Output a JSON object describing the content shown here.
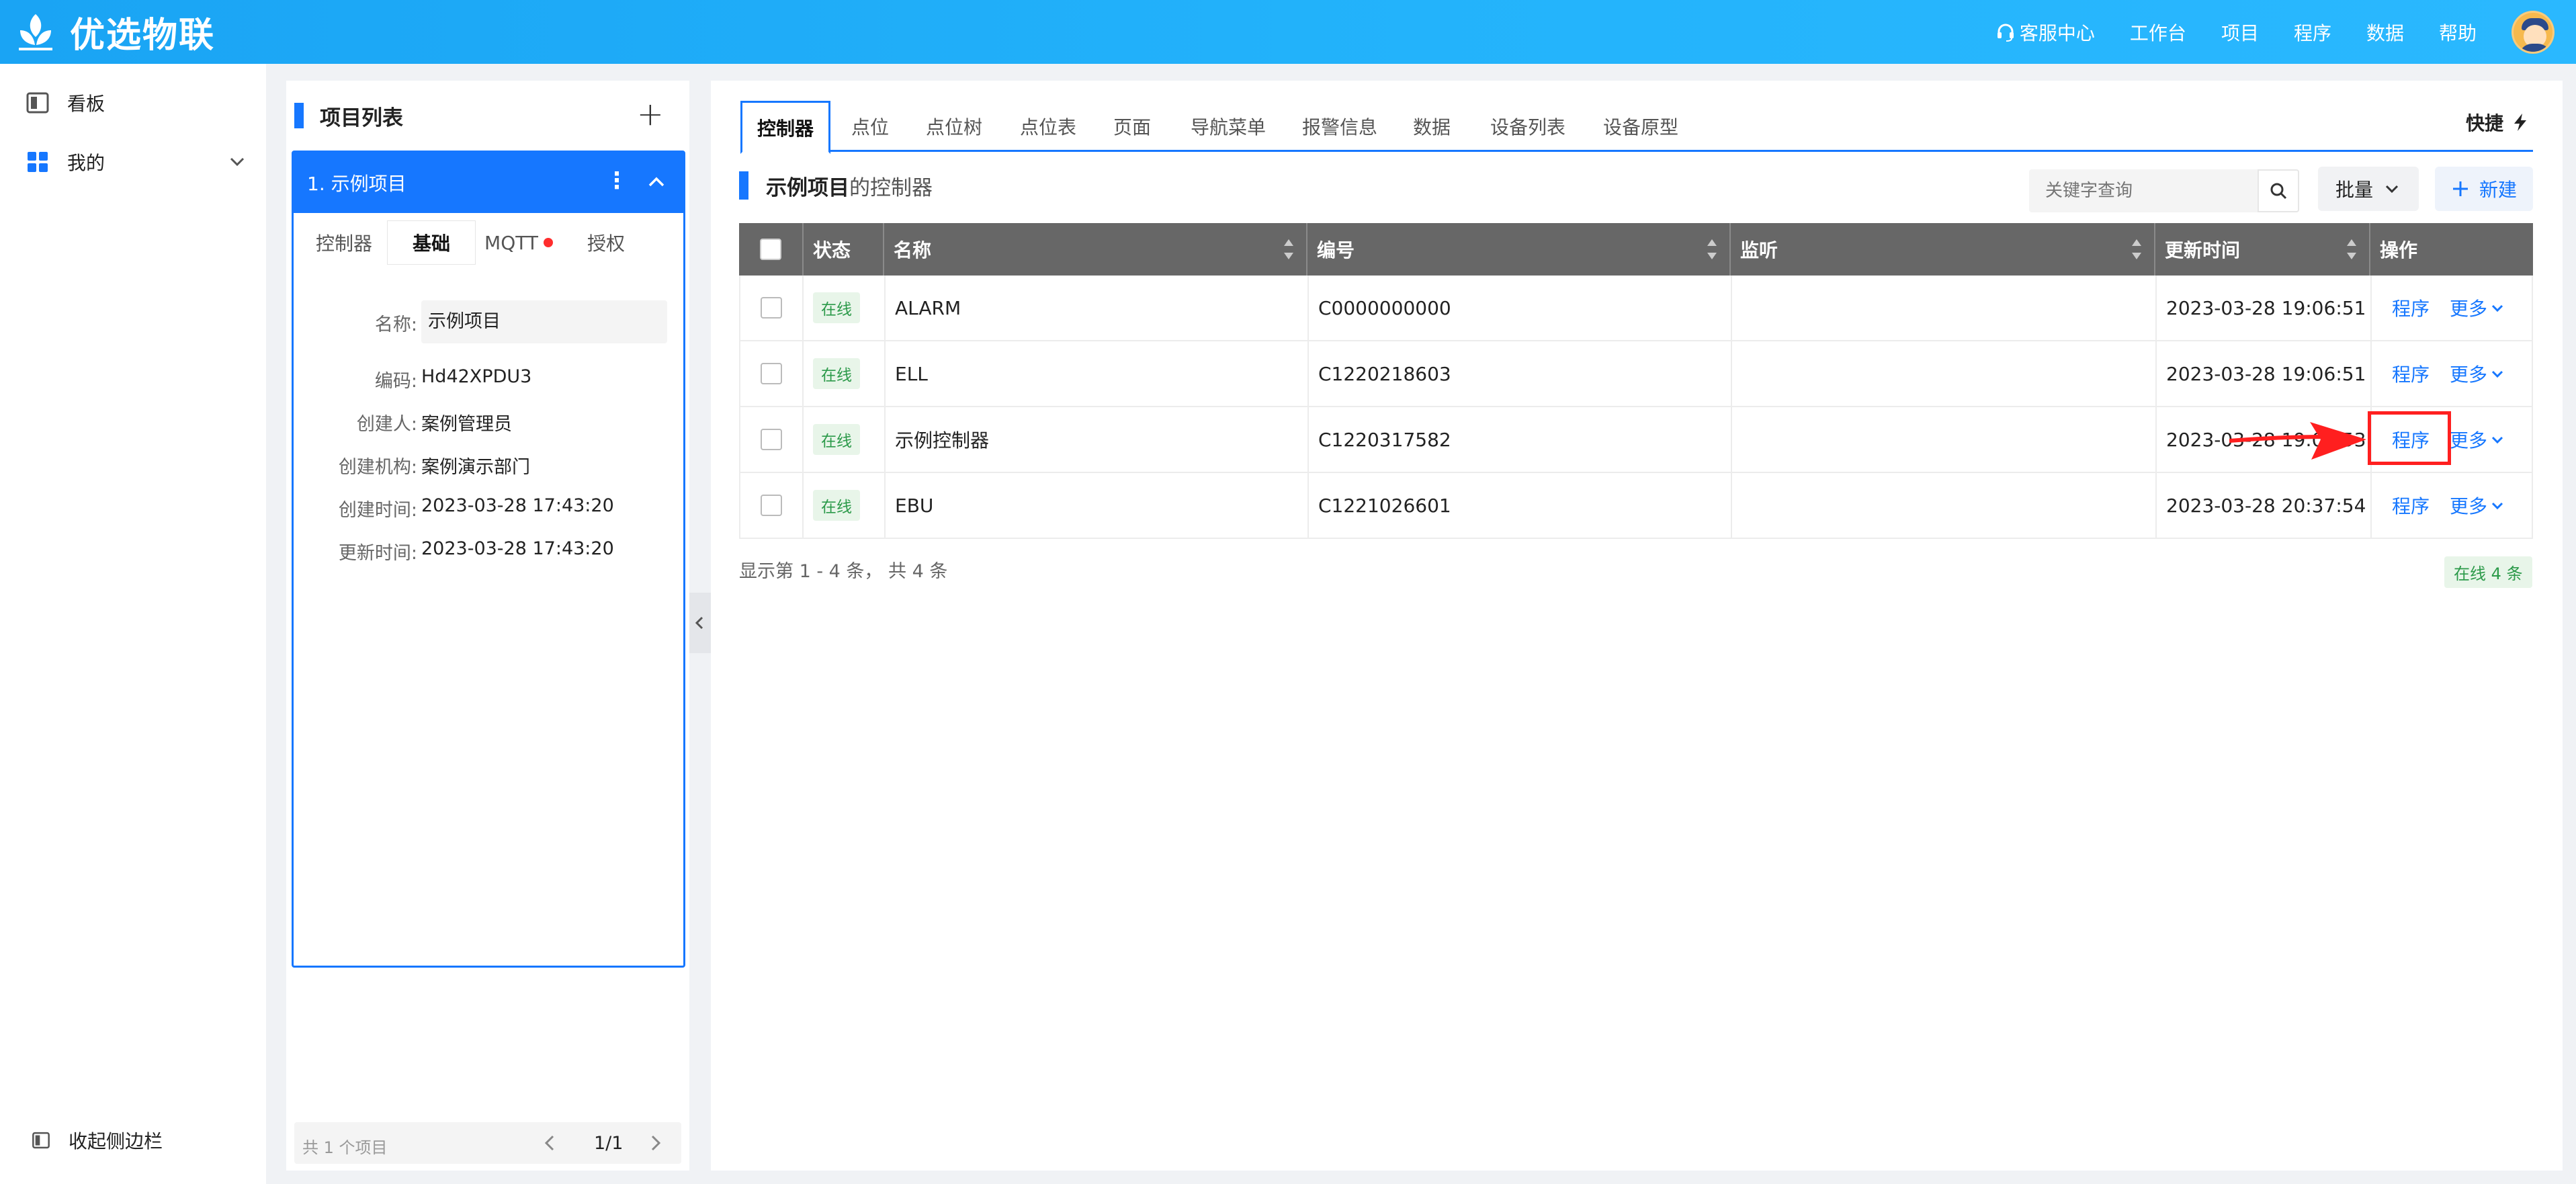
{
  "header": {
    "app_name": "优选物联",
    "nav": [
      {
        "label": "客服中心",
        "icon": "headset-icon"
      },
      {
        "label": "工作台"
      },
      {
        "label": "项目"
      },
      {
        "label": "程序"
      },
      {
        "label": "数据"
      },
      {
        "label": "帮助"
      }
    ]
  },
  "sidebar": {
    "items": [
      {
        "label": "看板",
        "icon": "board-icon"
      },
      {
        "label": "我的",
        "icon": "grid-icon"
      }
    ],
    "collapse_label": "收起侧边栏"
  },
  "project_panel": {
    "title": "项目列表",
    "project": {
      "name": "1. 示例项目",
      "tabs": [
        {
          "label": "控制器"
        },
        {
          "label": "基础",
          "active": true
        },
        {
          "label": "MQTT",
          "dot": true
        },
        {
          "label": "授权"
        }
      ],
      "fields": [
        {
          "label": "名称:",
          "value": "示例项目"
        },
        {
          "label": "编码:",
          "value": "Hd42XPDU3"
        },
        {
          "label": "创建人:",
          "value": "案例管理员"
        },
        {
          "label": "创建机构:",
          "value": "案例演示部门"
        },
        {
          "label": "创建时间:",
          "value": "2023-03-28 17:43:20"
        },
        {
          "label": "更新时间:",
          "value": "2023-03-28 17:43:20"
        }
      ]
    },
    "pager": {
      "total": "共 1 个项目",
      "page": "1/1"
    }
  },
  "main": {
    "tabs": [
      "控制器",
      "点位",
      "点位树",
      "点位表",
      "页面",
      "导航菜单",
      "报警信息",
      "数据",
      "设备列表",
      "设备原型"
    ],
    "active_tab": "控制器",
    "quick_label": "快捷",
    "section_project": "示例项目",
    "section_suffix": "的控制器",
    "search_placeholder": "关键字查询",
    "batch_label": "批量",
    "new_label": "新建",
    "table": {
      "columns": [
        "状态",
        "名称",
        "编号",
        "监听",
        "更新时间",
        "操作"
      ],
      "rows": [
        {
          "status": "在线",
          "name": "ALARM",
          "code": "C0000000000",
          "listen": "",
          "updated": "2023-03-28 19:06:51"
        },
        {
          "status": "在线",
          "name": "ELL",
          "code": "C1220218603",
          "listen": "",
          "updated": "2023-03-28 19:06:51"
        },
        {
          "status": "在线",
          "name": "示例控制器",
          "code": "C1220317582",
          "listen": "",
          "updated": "2023-03-28 19:06:53"
        },
        {
          "status": "在线",
          "name": "EBU",
          "code": "C1221026601",
          "listen": "",
          "updated": "2023-03-28 20:37:54"
        }
      ],
      "op_program": "程序",
      "op_more": "更多"
    },
    "footer_info": "显示第 1 - 4 条， 共 4 条",
    "online_count": "在线 4 条"
  },
  "colors": {
    "accent": "#1677ff",
    "header": "#23b3fb",
    "online": "#2c9a4a",
    "highlight": "#ff1f1f"
  }
}
